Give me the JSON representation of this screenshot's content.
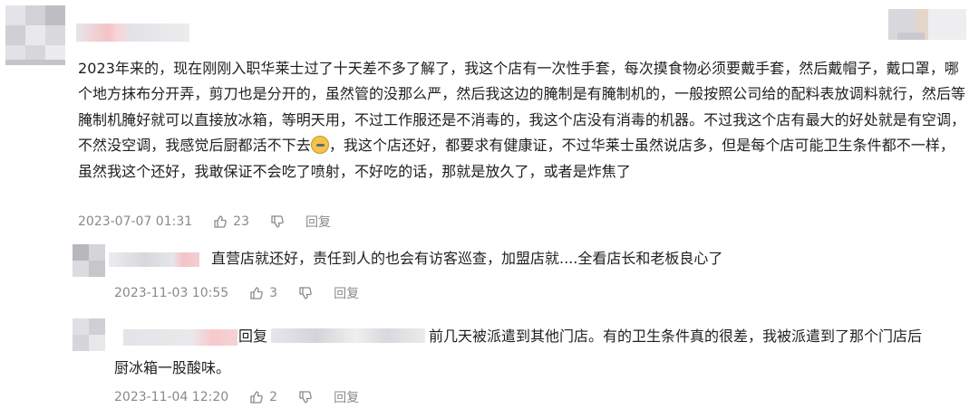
{
  "top_comment": {
    "text_before_emoji": "2023年来的，现在刚刚入职华莱士过了十天差不多了解了，我这个店有一次性手套，每次摸食物必须要戴手套，然后戴帽子，戴口罩，哪个地方抹布分开弄，剪刀也是分开的，虽然管的没那么严，然后我这边的腌制是有腌制机的，一般按照公司给的配料表放调料就行，然后等腌制机腌好就可以直接放冰箱，等明天用，不过工作服还是不消毒的，我这个店没有消毒的机器。不过我这个店有最大的好处就是有空调，不然没空调，我感觉后厨都活不下去",
    "emoji": "sweat-smile-emoji",
    "text_after_emoji": "，我这个店还好，都要求有健康证，不过华莱士虽然说店多，但是每个店可能卫生条件都不一样，虽然我这个还好，我敢保证不会吃了喷射，不好吃的话，那就是放久了，或者是炸焦了",
    "time": "2023-07-07 01:31",
    "likes": "23",
    "reply_label": "回复"
  },
  "replies": [
    {
      "text": "直营店就还好，责任到人的也会有访客巡查，加盟店就....全看店长和老板良心了",
      "time": "2023-11-03 10:55",
      "likes": "3",
      "reply_label": "回复"
    },
    {
      "reply_prefix": "回复",
      "text_line1": "前几天被派遣到其他门店。有的卫生条件真的很差，我被派遣到了那个门店后",
      "text_line2": "厨冰箱一股酸味。",
      "time": "2023-11-04 12:20",
      "likes": "2",
      "reply_label": "回复"
    }
  ],
  "colors": {
    "text": "#1f1f1f",
    "meta": "#8a8a8a",
    "blur_gray": "#d9d9dd",
    "blur_pink": "#f7c9cc"
  }
}
